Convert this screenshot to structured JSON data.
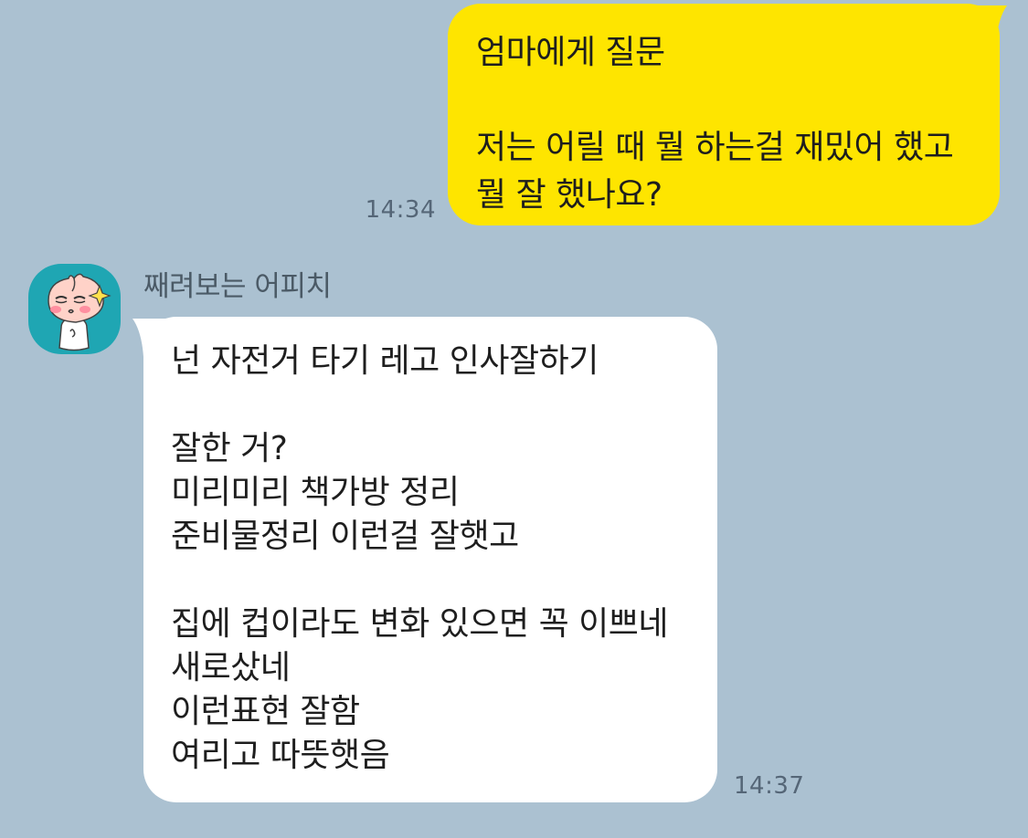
{
  "colors": {
    "background": "#abc1d1",
    "outgoing_bubble": "#fee500",
    "incoming_bubble": "#ffffff",
    "avatar_background": "#1fa6b3"
  },
  "messages": [
    {
      "direction": "outgoing",
      "text": "엄마에게 질문\n\n저는 어릴 때 뭘 하는걸 재밌어 했고\n뭘 잘 했나요?",
      "time": "14:34"
    },
    {
      "direction": "incoming",
      "sender": "째려보는 어피치",
      "avatar_icon": "apeach-character-icon",
      "text": "넌 자전거 타기 레고 인사잘하기\n\n잘한 거?\n미리미리 책가방 정리\n준비물정리 이런걸 잘햇고\n\n집에 컵이라도 변화 있으면 꼭 이쁘네\n새로샀네\n이런표현 잘함\n여리고 따뜻햇음",
      "time": "14:37"
    }
  ]
}
